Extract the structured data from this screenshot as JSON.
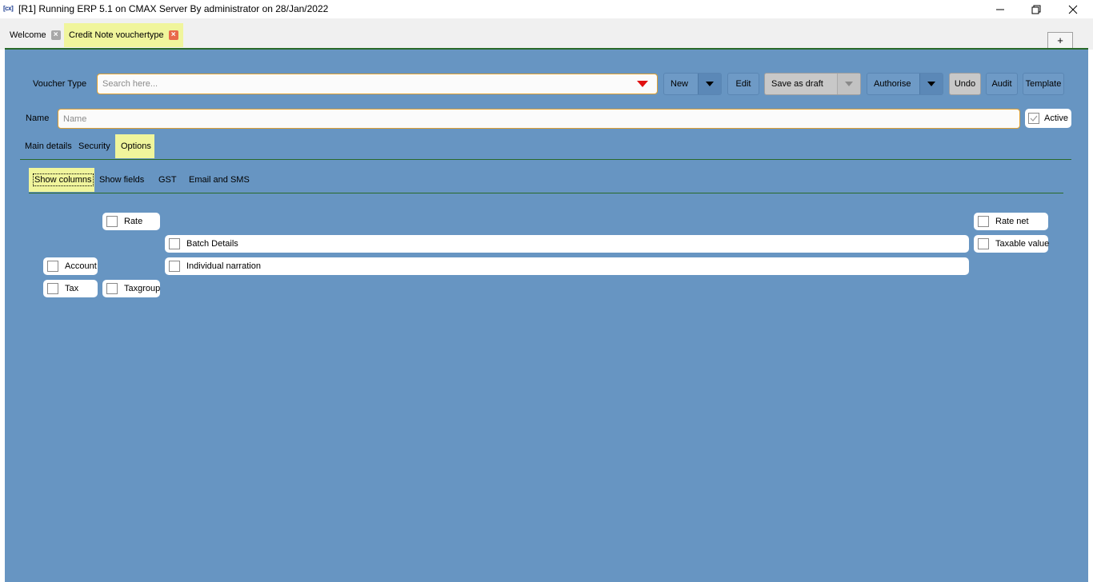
{
  "window": {
    "app_icon": "[cx]",
    "title": "[R1] Running ERP 5.1 on CMAX Server By administrator on 28/Jan/2022",
    "minimize_icon": "minimize-icon",
    "restore_icon": "restore-icon",
    "close_icon": "close-icon"
  },
  "tabs": [
    {
      "label": "Welcome",
      "close": "×",
      "active": false
    },
    {
      "label": "Credit Note vouchertype",
      "close": "×",
      "active": true
    }
  ],
  "add_tab_label": "+",
  "toolbar": {
    "voucher_type_label": "Voucher Type",
    "search_placeholder": "Search here...",
    "new_label": "New",
    "edit_label": "Edit",
    "save_draft_label": "Save as draft",
    "authorise_label": "Authorise",
    "undo_label": "Undo",
    "audit_label": "Audit",
    "template_label": "Template"
  },
  "name_row": {
    "label": "Name",
    "placeholder": "Name",
    "active_label": "Active",
    "active_checked": true
  },
  "form_tabs": [
    "Main details",
    "Security",
    "Options"
  ],
  "form_tab_active": "Options",
  "sub_tabs": [
    "Show columns",
    "Show fields",
    "GST",
    "Email and SMS"
  ],
  "sub_tab_active": "Show columns",
  "columns": {
    "rate": "Rate",
    "batch_details": "Batch Details",
    "account": "Account",
    "individual_narration": "Individual narration",
    "tax": "Tax",
    "taxgroup": "Taxgroup",
    "rate_net": "Rate net",
    "taxable_value": "Taxable value"
  },
  "colors": {
    "panel": "#6795c2",
    "highlight": "#f0f59c",
    "divider": "#2a6a2a",
    "dropdown_arrow": "#e01010"
  }
}
